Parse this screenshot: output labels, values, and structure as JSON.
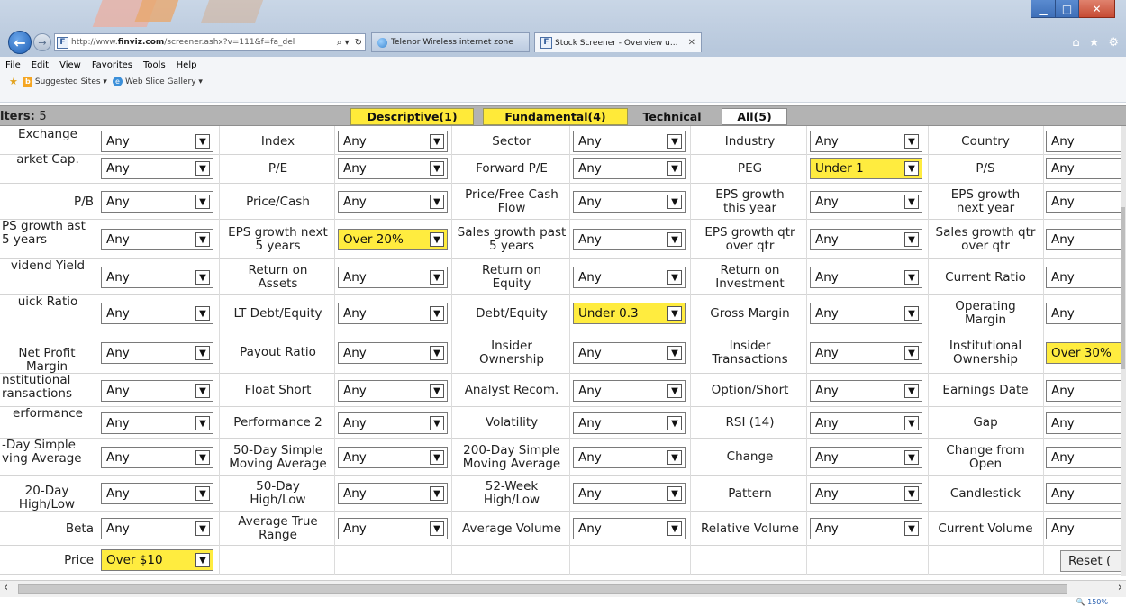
{
  "browser": {
    "address": "http://www.finviz.com/screener.ashx?v=111&f=fa_del",
    "address_domain": "finviz.com",
    "address_prefix": "http://www.",
    "address_suffix": "/screener.ashx?v=111&f=fa_del",
    "tab1_title": "Telenor Wireless internet zone",
    "tab2_title": "Stock Screener - Overview u...",
    "menu": [
      "File",
      "Edit",
      "View",
      "Favorites",
      "Tools",
      "Help"
    ],
    "favorites": {
      "suggested": "Suggested Sites ▾",
      "web_slice": "Web Slice Gallery ▾"
    },
    "zoom": "150%"
  },
  "screener": {
    "filters_label": "lters:",
    "filters_count": "5",
    "tabs": {
      "descriptive": "Descriptive(1)",
      "fundamental": "Fundamental(4)",
      "technical": "Technical",
      "all": "All(5)"
    },
    "rows": [
      [
        [
          "Exchange",
          "Any"
        ],
        [
          "Index",
          "Any"
        ],
        [
          "Sector",
          "Any"
        ],
        [
          "Industry",
          "Any"
        ],
        [
          "Country",
          "Any"
        ]
      ],
      [
        [
          "arket Cap.",
          "Any"
        ],
        [
          "P/E",
          "Any"
        ],
        [
          "Forward P/E",
          "Any"
        ],
        [
          "PEG",
          "Under 1"
        ],
        [
          "P/S",
          "Any"
        ]
      ],
      [
        [
          "P/B",
          "Any"
        ],
        [
          "Price/Cash",
          "Any"
        ],
        [
          "Price/Free Cash Flow",
          "Any"
        ],
        [
          "EPS growth this year",
          "Any"
        ],
        [
          "EPS growth next year",
          "Any"
        ]
      ],
      [
        [
          "PS growth ast 5 years",
          "Any"
        ],
        [
          "EPS growth next 5 years",
          "Over 20%"
        ],
        [
          "Sales growth past 5 years",
          "Any"
        ],
        [
          "EPS growth qtr over qtr",
          "Any"
        ],
        [
          "Sales growth qtr over qtr",
          "Any"
        ]
      ],
      [
        [
          "vidend Yield",
          "Any"
        ],
        [
          "Return on Assets",
          "Any"
        ],
        [
          "Return on Equity",
          "Any"
        ],
        [
          "Return on Investment",
          "Any"
        ],
        [
          "Current Ratio",
          "Any"
        ]
      ],
      [
        [
          "uick Ratio",
          "Any"
        ],
        [
          "LT Debt/Equity",
          "Any"
        ],
        [
          "Debt/Equity",
          "Under 0.3"
        ],
        [
          "Gross Margin",
          "Any"
        ],
        [
          "Operating Margin",
          "Any"
        ]
      ],
      [
        [
          "Net Profit Margin",
          "Any"
        ],
        [
          "Payout Ratio",
          "Any"
        ],
        [
          "Insider Ownership",
          "Any"
        ],
        [
          "Insider Transactions",
          "Any"
        ],
        [
          "Institutional Ownership",
          "Over 30%"
        ]
      ],
      [
        [
          "nstitutional ransactions",
          "Any"
        ],
        [
          "Float Short",
          "Any"
        ],
        [
          "Analyst Recom.",
          "Any"
        ],
        [
          "Option/Short",
          "Any"
        ],
        [
          "Earnings Date",
          "Any"
        ]
      ],
      [
        [
          "erformance",
          "Any"
        ],
        [
          "Performance 2",
          "Any"
        ],
        [
          "Volatility",
          "Any"
        ],
        [
          "RSI (14)",
          "Any"
        ],
        [
          "Gap",
          "Any"
        ]
      ],
      [
        [
          "-Day Simple ving Average",
          "Any"
        ],
        [
          "50-Day Simple Moving Average",
          "Any"
        ],
        [
          "200-Day Simple Moving Average",
          "Any"
        ],
        [
          "Change",
          "Any"
        ],
        [
          "Change from Open",
          "Any"
        ]
      ],
      [
        [
          "20-Day High/Low",
          "Any"
        ],
        [
          "50-Day High/Low",
          "Any"
        ],
        [
          "52-Week High/Low",
          "Any"
        ],
        [
          "Pattern",
          "Any"
        ],
        [
          "Candlestick",
          "Any"
        ]
      ],
      [
        [
          "Beta",
          "Any"
        ],
        [
          "Average True Range",
          "Any"
        ],
        [
          "Average Volume",
          "Any"
        ],
        [
          "Relative Volume",
          "Any"
        ],
        [
          "Current Volume",
          "Any"
        ]
      ],
      [
        [
          "Price",
          "Over $10"
        ]
      ]
    ],
    "highlighted": [
      "Under 1",
      "Over 20%",
      "Under 0.3",
      "Over 30%",
      "Over $10"
    ],
    "reset_label": "Reset (",
    "highlight_color": "#ffec3f",
    "tab_active_color": "#ffea39"
  }
}
